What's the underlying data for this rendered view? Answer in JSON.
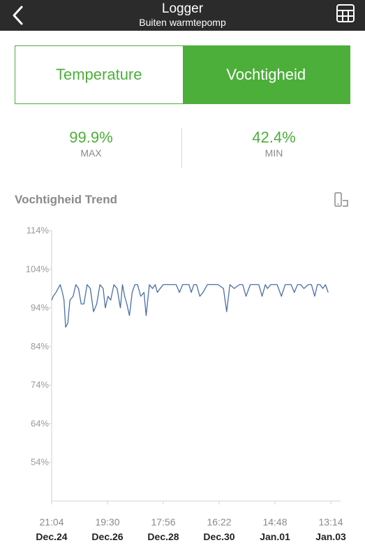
{
  "header": {
    "title": "Logger",
    "subtitle": "Buiten warmtepomp",
    "back_icon": "chevron-left-icon",
    "table_icon": "table-grid-icon"
  },
  "tabs": [
    {
      "label": "Temperature",
      "active": false
    },
    {
      "label": "Vochtigheid",
      "active": true
    }
  ],
  "stats": {
    "max": {
      "value": "99.9%",
      "label": "MAX"
    },
    "min": {
      "value": "42.4%",
      "label": "MIN"
    }
  },
  "trend": {
    "title": "Vochtigheid Trend",
    "rotate_icon": "rotate-device-icon"
  },
  "colors": {
    "accent": "#4caf3a",
    "header_bg": "#2b2b2b",
    "line": "#4a6fa5"
  },
  "chart_data": {
    "type": "line",
    "ylim": [
      44,
      114
    ],
    "yticks": [
      "114%",
      "104%",
      "94%",
      "84%",
      "74%",
      "64%",
      "54%"
    ],
    "ytick_values": [
      114,
      104,
      94,
      84,
      74,
      64,
      54
    ],
    "xticks": [
      {
        "time": "21:04",
        "date": "Dec.24"
      },
      {
        "time": "19:30",
        "date": "Dec.26"
      },
      {
        "time": "17:56",
        "date": "Dec.28"
      },
      {
        "time": "16:22",
        "date": "Dec.30"
      },
      {
        "time": "14:48",
        "date": "Jan.01"
      },
      {
        "time": "13:14",
        "date": "Jan.03"
      }
    ],
    "xlim": [
      0,
      5.2
    ],
    "series": [
      {
        "x": [
          0,
          0.03,
          0.08,
          0.12,
          0.16,
          0.2,
          0.23,
          0.26,
          0.3,
          0.34,
          0.4,
          0.45,
          0.5,
          0.55,
          0.6,
          0.66,
          0.72,
          0.78,
          0.84,
          0.9,
          0.96,
          1.0,
          1.05,
          1.1,
          1.16,
          1.22,
          1.28,
          1.32,
          1.36,
          1.4,
          1.45,
          1.5,
          1.55,
          1.6,
          1.66,
          1.72,
          1.76,
          1.82,
          1.88,
          1.93,
          1.97,
          2.02,
          2.08,
          2.14,
          2.2,
          2.26,
          2.32,
          2.38,
          2.44,
          2.5,
          2.56,
          2.6,
          2.65,
          2.7,
          2.76,
          2.82,
          2.9,
          3.0,
          3.1,
          3.2,
          3.26,
          3.32,
          3.4,
          3.5,
          3.56,
          3.62,
          3.7,
          3.8,
          3.86,
          3.92,
          3.98,
          4.02,
          4.08,
          4.14,
          4.2,
          4.28,
          4.35,
          4.4,
          4.46,
          4.52,
          4.58,
          4.64,
          4.7,
          4.78,
          4.84,
          4.9,
          4.95,
          5.0,
          5.05,
          5.1,
          5.15
        ],
        "y": [
          96,
          97,
          98,
          99,
          100,
          98,
          96,
          89,
          90,
          96,
          97,
          100,
          99,
          95,
          95,
          100,
          99,
          93,
          95,
          100,
          99,
          94,
          97,
          96,
          100,
          99,
          94,
          100,
          97,
          95,
          92,
          98,
          100,
          100,
          97,
          98,
          92,
          100,
          99,
          100,
          98,
          99,
          100,
          100,
          100,
          100,
          100,
          98,
          100,
          100,
          100,
          98,
          100,
          100,
          97,
          98,
          100,
          100,
          100,
          99,
          93,
          100,
          99,
          100,
          100,
          97,
          100,
          100,
          100,
          97,
          100,
          99,
          100,
          100,
          100,
          97,
          100,
          100,
          100,
          98,
          100,
          100,
          99,
          100,
          100,
          97,
          100,
          100,
          99,
          100,
          98
        ]
      }
    ]
  }
}
